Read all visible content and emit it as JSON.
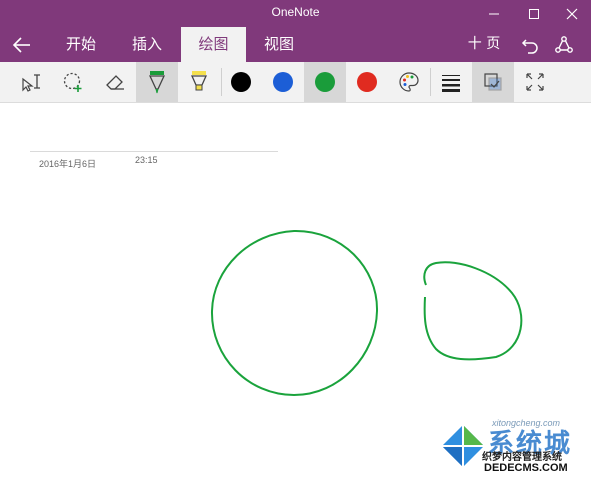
{
  "window": {
    "title": "OneNote"
  },
  "tabs": [
    {
      "label": "开始"
    },
    {
      "label": "插入"
    },
    {
      "label": "绘图",
      "active": true
    },
    {
      "label": "视图"
    }
  ],
  "header": {
    "add_page_label": "十 页"
  },
  "colors": {
    "brand": "#80397b",
    "black": "#000000",
    "blue": "#1c5ed6",
    "green": "#1a9c3a",
    "red": "#e02b20",
    "ink": "#1aa33c"
  },
  "toolbar": {
    "tools": [
      "type-select-icon",
      "lasso-select-icon",
      "eraser-icon",
      "green-pen-icon",
      "highlighter-icon",
      "black-color",
      "blue-color",
      "green-color",
      "red-color",
      "palette-icon",
      "line-thickness-icon",
      "ink-to-shape-icon",
      "fullscreen-icon"
    ],
    "selected": [
      "green-pen-icon",
      "green-color",
      "ink-to-shape-icon"
    ]
  },
  "page": {
    "date": "2016年1月6日",
    "time": "23:15"
  },
  "watermark": {
    "brand": "系统城",
    "line1": "织梦内容管理系统",
    "line2": "DEDECMS.COM",
    "url": "xitongcheng.com"
  }
}
